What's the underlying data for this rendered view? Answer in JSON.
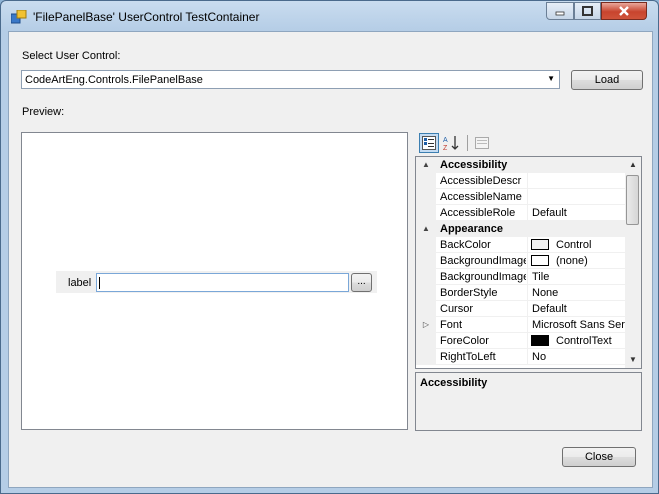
{
  "window": {
    "title": "'FilePanelBase' UserControl TestContainer"
  },
  "form": {
    "select_label": "Select User Control:",
    "combo_value": "CodeArtEng.Controls.FilePanelBase",
    "load_button": "Load",
    "preview_label": "Preview:",
    "close_button": "Close"
  },
  "preview": {
    "control_label": "label",
    "control_input_value": "",
    "browse_button": "..."
  },
  "property_grid": {
    "toolbar": [
      "categorized-icon",
      "alphabetical-icon",
      "property-pages-icon"
    ],
    "rows": [
      {
        "type": "category",
        "name": "Accessibility",
        "value": "",
        "expander": "▲"
      },
      {
        "type": "prop",
        "name": "AccessibleDescr",
        "value": ""
      },
      {
        "type": "prop",
        "name": "AccessibleName",
        "value": ""
      },
      {
        "type": "prop",
        "name": "AccessibleRole",
        "value": "Default"
      },
      {
        "type": "category",
        "name": "Appearance",
        "value": "",
        "expander": "▲"
      },
      {
        "type": "prop",
        "name": "BackColor",
        "value": "Control",
        "swatch": "#f0f0f0"
      },
      {
        "type": "prop",
        "name": "BackgroundImage",
        "value": "(none)",
        "swatch": "#ffffff"
      },
      {
        "type": "prop",
        "name": "BackgroundImage",
        "value": "Tile"
      },
      {
        "type": "prop",
        "name": "BorderStyle",
        "value": "None"
      },
      {
        "type": "prop",
        "name": "Cursor",
        "value": "Default"
      },
      {
        "type": "prop",
        "name": "Font",
        "value": "Microsoft Sans Serif",
        "expander": "▷"
      },
      {
        "type": "prop",
        "name": "ForeColor",
        "value": "ControlText",
        "swatch": "#000000"
      },
      {
        "type": "prop",
        "name": "RightToLeft",
        "value": "No"
      }
    ],
    "help_title": "Accessibility"
  },
  "colors": {
    "title_bar": "#b5cde6",
    "close_button": "#c8442e",
    "selection_border": "#3c7fb1"
  }
}
